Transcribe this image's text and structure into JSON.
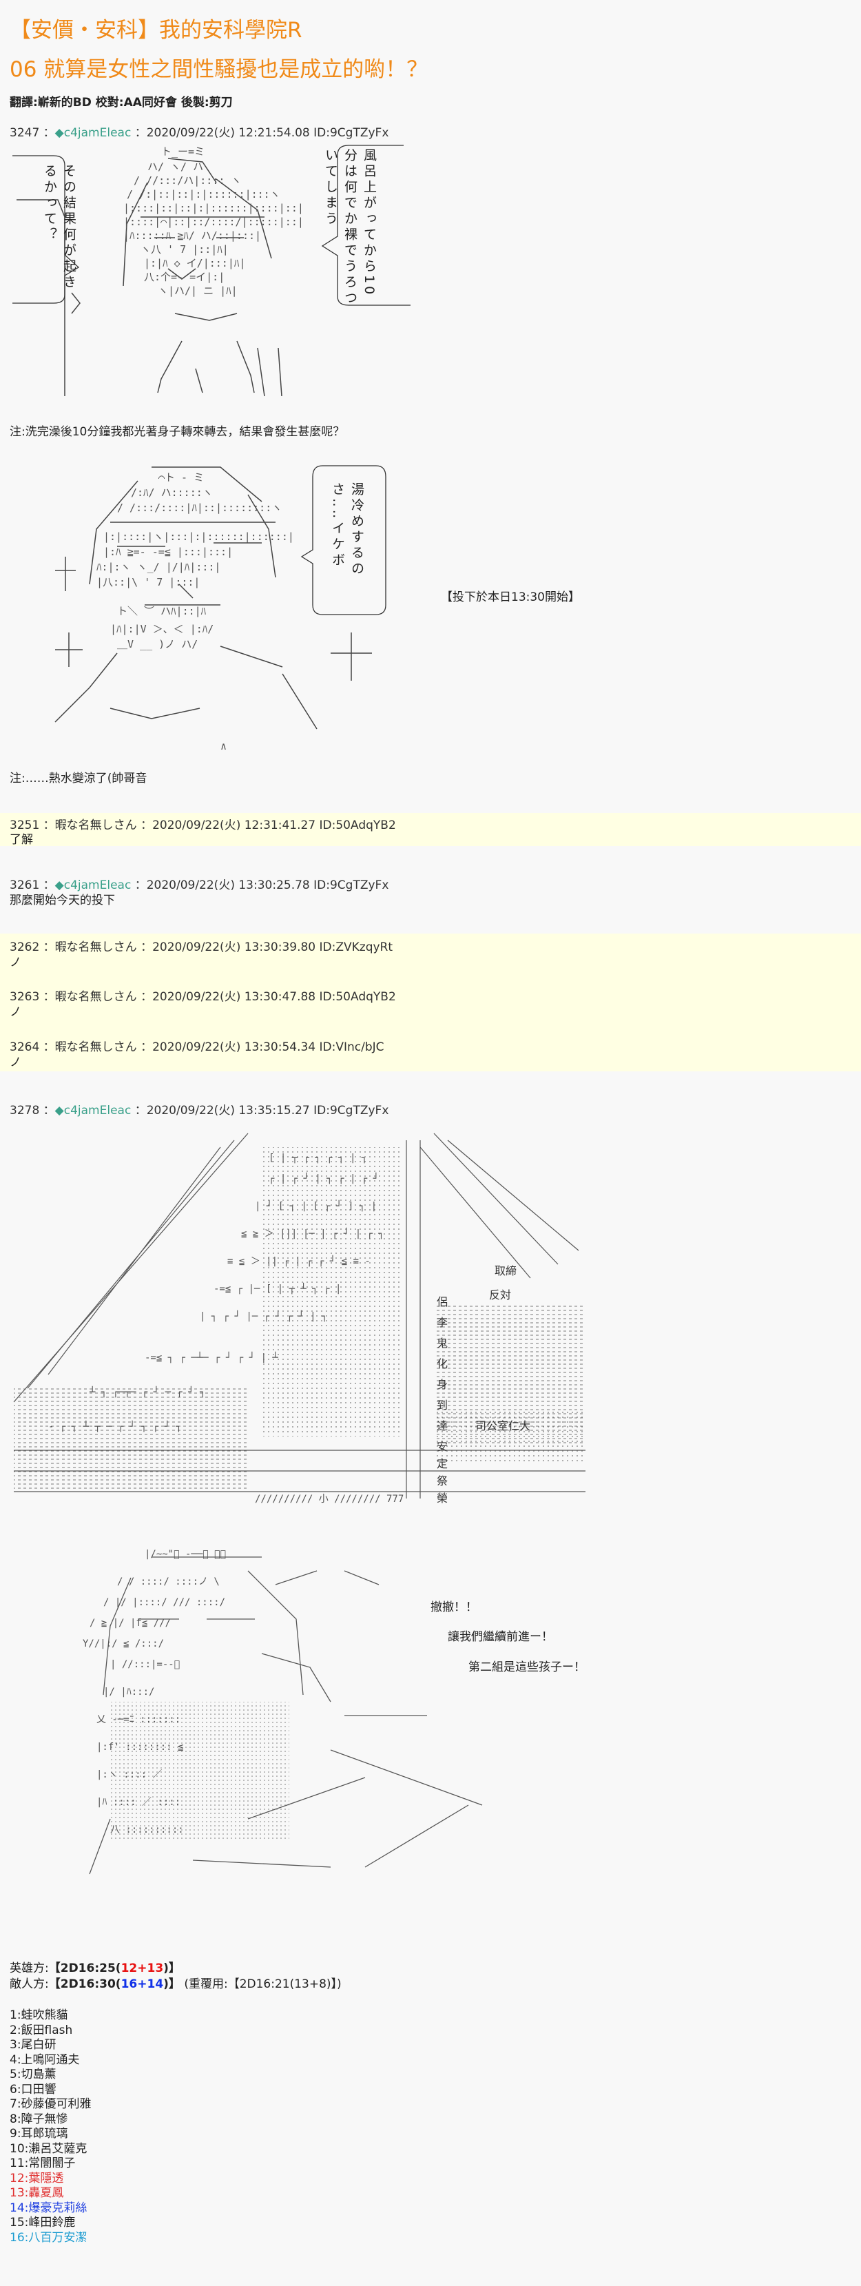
{
  "title": {
    "line1": "【安價・安科】我的安科學院R",
    "line2": "06 就算是女性之間性騷擾也是成立的喲！？"
  },
  "credits": "翻譯:嶄新的BD 校對:AA同好會 後製:剪刀",
  "posts": [
    {
      "num": "3247",
      "name": "◆c4jamEleac",
      "meta": "2020/09/22(火) 12:21:54.08 ID:9CgTZyFx"
    },
    {
      "num": "3251",
      "name": "暇な名無しさん",
      "meta": "2020/09/22(火) 12:31:41.27 ID:50AdqYB2",
      "body": "了解"
    },
    {
      "num": "3261",
      "name": "◆c4jamEleac",
      "meta": "2020/09/22(火) 13:30:25.78 ID:9CgTZyFx",
      "body": "那麼開始今天的投下"
    },
    {
      "num": "3262",
      "name": "暇な名無しさん",
      "meta": "2020/09/22(火) 13:30:39.80 ID:ZVKzqyRt",
      "body": "ノ"
    },
    {
      "num": "3263",
      "name": "暇な名無しさん",
      "meta": "2020/09/22(火) 13:30:47.88 ID:50AdqYB2",
      "body": "ノ"
    },
    {
      "num": "3264",
      "name": "暇な名無しさん",
      "meta": "2020/09/22(火) 13:30:54.34 ID:VInc/bJC",
      "body": "ノ"
    },
    {
      "num": "3278",
      "name": "◆c4jamEleac",
      "meta": "2020/09/22(火) 13:35:15.27 ID:9CgTZyFx"
    }
  ],
  "scene1": {
    "left_bubble": "その結果何が起きるかって？",
    "right_bubble": "風呂上がってから10分は何でか裸でうろついてしまう",
    "note": "注:洗完澡後10分鐘我都光著身子轉來轉去，結果會發生甚麼呢？"
  },
  "scene2": {
    "bubble": "湯冷めするのさ‥‥イケボ",
    "stamp": "【投下於本日13:30開始】",
    "note": "注:……熱水變涼了(帥哥音"
  },
  "scene3": {
    "labels": [
      "取締",
      "反対",
      "侶",
      "李",
      "鬼",
      "化",
      "身",
      "到",
      "達",
      "安",
      "定",
      "祭",
      "榮",
      "司公室仁大"
    ]
  },
  "scene4": {
    "lines": [
      "撤撤！！",
      "讓我們繼續前進ー！",
      "第二組是這些孩子ー！"
    ]
  },
  "scores": {
    "hero_label": "英雄方:",
    "hero_main": "【2D16:25(",
    "hero_red": "12",
    "hero_plus": "+",
    "hero_red2": "13",
    "hero_end": ")】",
    "enemy_label": "敵人方:",
    "enemy_main": "【2D16:30(",
    "enemy_blue": "16",
    "enemy_plus": "+",
    "enemy_blue2": "14",
    "enemy_end": ")】",
    "reuse": "(重覆用:【2D16:21(13+8)】)"
  },
  "roster": [
    {
      "text": "1:蛙吹熊貓",
      "color": "normal"
    },
    {
      "text": "2:飯田flash",
      "color": "normal"
    },
    {
      "text": "3:尾白研",
      "color": "normal"
    },
    {
      "text": "4:上鳴阿通夫",
      "color": "normal"
    },
    {
      "text": "5:切島薰",
      "color": "normal"
    },
    {
      "text": "6:口田響",
      "color": "normal"
    },
    {
      "text": "7:砂藤優可利雅",
      "color": "normal"
    },
    {
      "text": "8:障子無慘",
      "color": "normal"
    },
    {
      "text": "9:耳郎琉璃",
      "color": "normal"
    },
    {
      "text": "10:瀨呂艾薩克",
      "color": "normal"
    },
    {
      "text": "11:常闇闇子",
      "color": "normal"
    },
    {
      "text": "12:葉隱透",
      "color": "red"
    },
    {
      "text": "13:轟夏鳳",
      "color": "red"
    },
    {
      "text": "14:爆豪克莉絲",
      "color": "blue"
    },
    {
      "text": "15:峰田鈴鹿",
      "color": "normal"
    },
    {
      "text": "16:八百万安潔",
      "color": "teal"
    }
  ]
}
